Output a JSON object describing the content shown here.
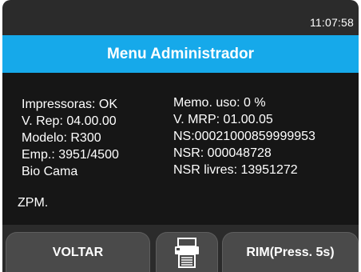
{
  "status": {
    "time": "11:07:58"
  },
  "header": {
    "title": "Menu Administrador"
  },
  "info": {
    "left": [
      "Impressoras: OK",
      "V. Rep: 04.00.00",
      "Modelo: R300",
      "Emp.: 3951/4500",
      "Bio Cama"
    ],
    "right": [
      "Memo. uso: 0 %",
      "V. MRP: 01.00.05",
      "NS:00021000859999953",
      "NSR: 000048728",
      "NSR livres: 13951272"
    ],
    "zpm": "ZPM."
  },
  "buttons": {
    "back": "VOLTAR",
    "print_icon": "printer-icon",
    "rim": "RIM(Press. 5s)"
  }
}
